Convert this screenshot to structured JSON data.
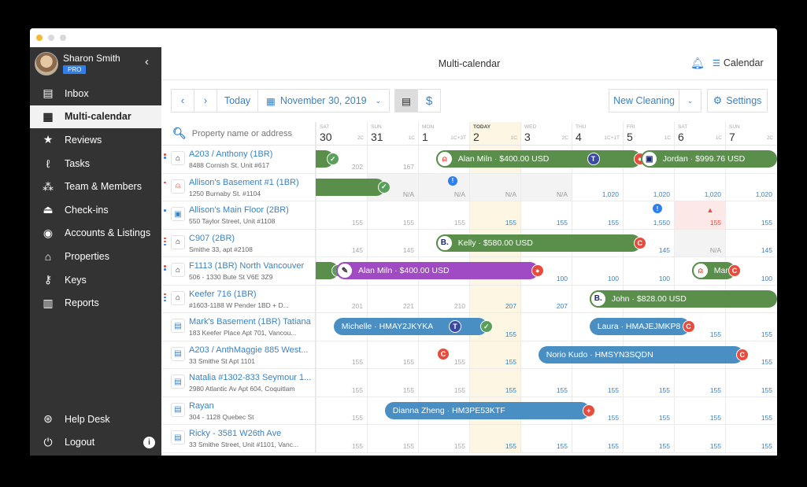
{
  "window": {
    "dots": [
      "#f5b82e",
      "#d9d9d9",
      "#d9d9d9"
    ]
  },
  "user": {
    "name": "Sharon Smith",
    "plan": "PRO"
  },
  "sidebar": {
    "items": [
      {
        "label": "Inbox",
        "icon": "inbox-icon",
        "glyph": "▤"
      },
      {
        "label": "Multi-calendar",
        "icon": "calendar-icon",
        "glyph": "▦",
        "active": true
      },
      {
        "label": "Reviews",
        "icon": "star-icon",
        "glyph": "★"
      },
      {
        "label": "Tasks",
        "icon": "vacuum-icon",
        "glyph": "ℓ"
      },
      {
        "label": "Team & Members",
        "icon": "team-icon",
        "glyph": "⁂"
      },
      {
        "label": "Check-ins",
        "icon": "bell-desk-icon",
        "glyph": "⏏"
      },
      {
        "label": "Accounts & Listings",
        "icon": "account-icon",
        "glyph": "◉"
      },
      {
        "label": "Properties",
        "icon": "home-icon",
        "glyph": "⌂"
      },
      {
        "label": "Keys",
        "icon": "key-icon",
        "glyph": "⚷"
      },
      {
        "label": "Reports",
        "icon": "chart-icon",
        "glyph": "▥"
      }
    ],
    "bottom": [
      {
        "label": "Help Desk",
        "icon": "lifebuoy-icon",
        "glyph": "⊛"
      },
      {
        "label": "Logout",
        "icon": "power-icon",
        "glyph": "⏻"
      }
    ],
    "info_glyph": "i"
  },
  "header": {
    "title": "Multi-calendar",
    "calendar_label": "Calendar"
  },
  "toolbar": {
    "prev": "‹",
    "next": "›",
    "today": "Today",
    "date": "November 30, 2019",
    "new_cleaning": "New Cleaning",
    "settings": "Settings",
    "dollar": "$"
  },
  "search": {
    "placeholder": "Property name or address"
  },
  "days": [
    {
      "dow": "SAT",
      "date": "30",
      "count": "2C"
    },
    {
      "dow": "SUN",
      "date": "31",
      "count": "1C"
    },
    {
      "dow": "MON",
      "date": "1",
      "count": "1C+3T"
    },
    {
      "dow": "TODAY",
      "date": "2",
      "count": "1C",
      "today": true
    },
    {
      "dow": "WED",
      "date": "3",
      "count": "2C"
    },
    {
      "dow": "THU",
      "date": "4",
      "count": "1C+1T"
    },
    {
      "dow": "FRI",
      "date": "5",
      "count": "1C"
    },
    {
      "dow": "SAT",
      "date": "6",
      "count": "1C"
    },
    {
      "dow": "SUN",
      "date": "7",
      "count": "2C"
    }
  ],
  "properties": [
    {
      "name": "A203 / Anthony (1BR)",
      "address": "8488 Cornish St. Unit #617",
      "icon": "home",
      "dots": [
        "#e74c3c",
        "#2f80ed"
      ],
      "prices": [
        "202",
        "167",
        "",
        "",
        "",
        "",
        "",
        "",
        ""
      ]
    },
    {
      "name": "Allison's Basement #1 (1BR)",
      "address": "1250 Burnaby St. #1104",
      "icon": "airbnb",
      "dots": [
        "#e74c3c"
      ],
      "prices": [
        "",
        "N/A",
        "N/A",
        "N/A",
        "N/A",
        "1,020",
        "1,020",
        "1,020",
        "1,020"
      ]
    },
    {
      "name": "Allison's Main Floor (2BR)",
      "address": "550 Taylor Street, Unit #1108",
      "icon": "booking",
      "dots": [
        "#2f80ed"
      ],
      "prices": [
        "155",
        "155",
        "155",
        "155",
        "155",
        "155",
        "1,550",
        "155",
        "155"
      ]
    },
    {
      "name": "C907 (2BR)",
      "address": "Smithe 33, apt #2108",
      "icon": "home",
      "dots": [
        "#e74c3c",
        "#e74c3c",
        "#2f80ed"
      ],
      "prices": [
        "145",
        "145",
        "",
        "",
        "",
        "",
        "145",
        "N/A",
        "145"
      ]
    },
    {
      "name": "F1113 (1BR) North Vancouver",
      "address": "506 - 1330 Bute St V6E 3Z9",
      "icon": "home",
      "dots": [
        "#e74c3c",
        "#2f80ed"
      ],
      "prices": [
        "",
        "",
        "",
        "",
        "100",
        "100",
        "100",
        "",
        "100"
      ]
    },
    {
      "name": "Keefer 716 (1BR)",
      "address": "#1603-1188 W Pender 1BD + D...",
      "icon": "home",
      "dots": [
        "#e74c3c",
        "#2f80ed",
        "#2f80ed"
      ],
      "prices": [
        "201",
        "221",
        "210",
        "207",
        "207",
        "",
        "",
        "",
        ""
      ]
    },
    {
      "name": "Mark's Basement (1BR) Tatiana",
      "address": "183 Keefer Place Apt 701, Vancou...",
      "icon": "hm",
      "dots": [],
      "prices": [
        "",
        "",
        "",
        "155",
        "",
        "",
        "",
        "155",
        "155"
      ]
    },
    {
      "name": "A203 / AnthMaggie 885 West...",
      "address": "33 Smithe St Apt 1101",
      "icon": "hm",
      "dots": [],
      "prices": [
        "155",
        "155",
        "155",
        "155",
        "",
        "",
        "",
        "",
        "155"
      ]
    },
    {
      "name": "Natalia #1302-833 Seymour 1...",
      "address": "2980 Atlantic Av Apt 604, Coquitlam",
      "icon": "hm",
      "dots": [],
      "prices": [
        "155",
        "155",
        "155",
        "155",
        "155",
        "155",
        "155",
        "155",
        "155"
      ]
    },
    {
      "name": "Rayan",
      "address": "304 - 1128 Quebec St",
      "icon": "hm",
      "dots": [],
      "prices": [
        "155",
        "",
        "",
        "",
        "",
        "155",
        "155",
        "155",
        "155"
      ]
    },
    {
      "name": "Ricky - 3581 W26th Ave",
      "address": "33 Smithe Street, Unit #1101, Vanc...",
      "icon": "hm",
      "dots": [],
      "prices": [
        "155",
        "155",
        "155",
        "155",
        "155",
        "155",
        "155",
        "155",
        "155"
      ]
    }
  ],
  "bookings": [
    {
      "row": 0,
      "start": -0.3,
      "end": 0.35,
      "color": "green",
      "label": "",
      "end_badge": "check"
    },
    {
      "row": 0,
      "start": 2.35,
      "end": 6.35,
      "color": "green",
      "label": "Alan Miln · $400.00 USD",
      "channel": "airbnb",
      "mid_badge": "T",
      "end_badge": "guest"
    },
    {
      "row": 0,
      "start": 6.35,
      "end": 9.3,
      "color": "green",
      "label": "Jordan · $999.76 USD",
      "channel": "booking"
    },
    {
      "row": 1,
      "start": -0.3,
      "end": 1.35,
      "color": "green",
      "label": "",
      "end_badge": "check"
    },
    {
      "row": 3,
      "start": 2.35,
      "end": 6.35,
      "color": "green",
      "label": "Kelly · $580.00 USD",
      "channel": "B.",
      "end_badge": "C"
    },
    {
      "row": 4,
      "start": -0.3,
      "end": 0.45,
      "color": "green",
      "label": "",
      "end_badge": "check"
    },
    {
      "row": 4,
      "start": 0.4,
      "end": 4.35,
      "color": "purple",
      "label": "Alan Miln · $400.00 USD",
      "channel": "pen",
      "end_badge": "guest"
    },
    {
      "row": 4,
      "start": 7.35,
      "end": 8.2,
      "color": "green",
      "label": "Marry",
      "channel": "airbnb",
      "end_badge": "C"
    },
    {
      "row": 5,
      "start": 5.35,
      "end": 9.3,
      "color": "green",
      "label": "John · $828.00 USD",
      "channel": "B."
    },
    {
      "row": 6,
      "start": 0.35,
      "end": 3.35,
      "color": "blue",
      "label": "Michelle · HMAY2JKYKA",
      "mid_badge": "T",
      "end_badge": "check"
    },
    {
      "row": 6,
      "start": 5.35,
      "end": 7.3,
      "color": "blue",
      "label": "Laura · HMAJEJMKP8",
      "end_badge": "C"
    },
    {
      "row": 7,
      "start": 4.35,
      "end": 8.35,
      "color": "blue",
      "label": "Norio Kudo · HMSYN3SQDN",
      "end_badge": "C"
    },
    {
      "row": 9,
      "start": 1.35,
      "end": 5.35,
      "color": "blue",
      "label": "Dianna Zheng · HM3PE53KTF",
      "end_badge": "plus"
    }
  ],
  "markers": [
    {
      "row": 1,
      "col": 2,
      "type": "info"
    },
    {
      "row": 2,
      "col": 6,
      "type": "info"
    },
    {
      "row": 2,
      "col": 7,
      "type": "warning"
    },
    {
      "row": 7,
      "col": 2,
      "type": "C"
    }
  ],
  "colors": {
    "accent": "#3b82c4",
    "green": "#5a8f4b",
    "blue": "#4a8fc4",
    "purple": "#a04ac4",
    "red": "#e74c3c",
    "today": "#fdf6e3"
  }
}
